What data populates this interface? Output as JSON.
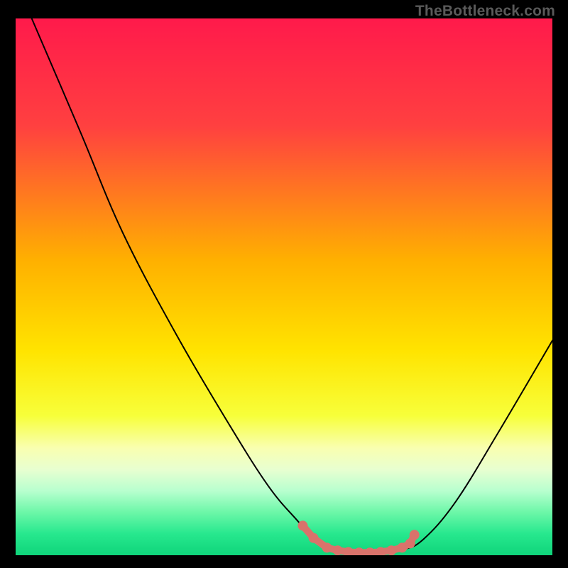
{
  "watermark": "TheBottleneck.com",
  "chart_data": {
    "type": "line",
    "title": "",
    "xlabel": "",
    "ylabel": "",
    "xlim": [
      0,
      100
    ],
    "ylim": [
      0,
      100
    ],
    "background_gradient": {
      "stops": [
        {
          "offset": 0,
          "color": "#ff1a4b"
        },
        {
          "offset": 20,
          "color": "#ff4040"
        },
        {
          "offset": 45,
          "color": "#ffb000"
        },
        {
          "offset": 62,
          "color": "#ffe400"
        },
        {
          "offset": 74,
          "color": "#f7ff3a"
        },
        {
          "offset": 80,
          "color": "#f9ffb0"
        },
        {
          "offset": 84,
          "color": "#e8ffd0"
        },
        {
          "offset": 88,
          "color": "#b8ffcf"
        },
        {
          "offset": 92,
          "color": "#6cf7a8"
        },
        {
          "offset": 96,
          "color": "#27e88e"
        },
        {
          "offset": 100,
          "color": "#0fd47a"
        }
      ]
    },
    "series": [
      {
        "name": "bottleneck-curve",
        "color": "#000000",
        "width": 2,
        "points": [
          {
            "x": 3,
            "y": 100
          },
          {
            "x": 12,
            "y": 79
          },
          {
            "x": 20,
            "y": 60
          },
          {
            "x": 30,
            "y": 41
          },
          {
            "x": 40,
            "y": 24
          },
          {
            "x": 47,
            "y": 13
          },
          {
            "x": 52,
            "y": 7
          },
          {
            "x": 56,
            "y": 3
          },
          {
            "x": 60,
            "y": 1
          },
          {
            "x": 66,
            "y": 0
          },
          {
            "x": 72,
            "y": 1
          },
          {
            "x": 76,
            "y": 3
          },
          {
            "x": 82,
            "y": 10
          },
          {
            "x": 90,
            "y": 23
          },
          {
            "x": 100,
            "y": 40
          }
        ]
      }
    ],
    "overlay": {
      "name": "highlight-dots",
      "color": "#d9736b",
      "dot_radius": 7,
      "thick_radius": 5,
      "points": [
        {
          "x": 53.5,
          "y": 5.5
        },
        {
          "x": 55.5,
          "y": 3.2
        },
        {
          "x": 58,
          "y": 1.4
        },
        {
          "x": 60,
          "y": 0.9
        },
        {
          "x": 62,
          "y": 0.6
        },
        {
          "x": 64,
          "y": 0.5
        },
        {
          "x": 66,
          "y": 0.5
        },
        {
          "x": 68,
          "y": 0.6
        },
        {
          "x": 70,
          "y": 0.9
        },
        {
          "x": 72,
          "y": 1.4
        },
        {
          "x": 73.5,
          "y": 2.2
        },
        {
          "x": 74.3,
          "y": 3.8
        }
      ]
    }
  }
}
